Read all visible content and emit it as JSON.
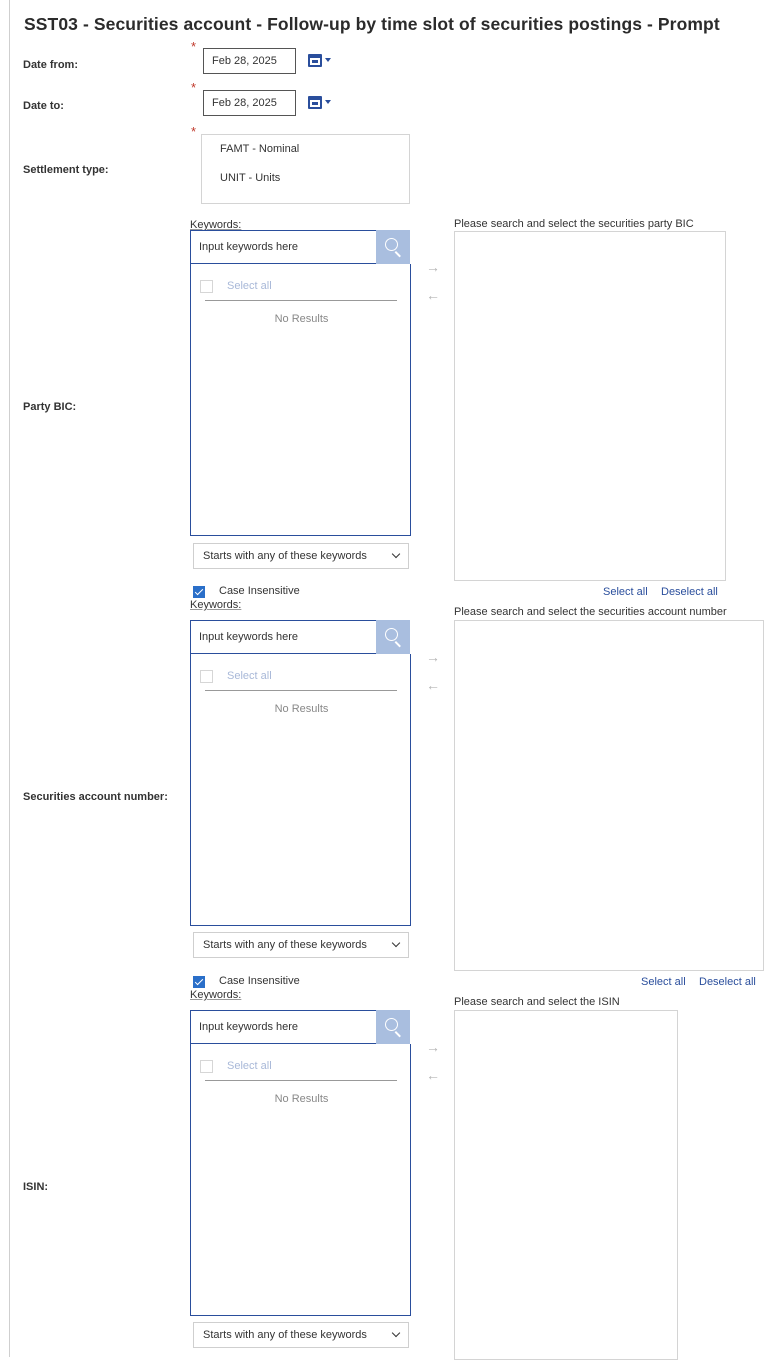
{
  "page": {
    "title": "SST03 - Securities account - Follow-up by time slot of securities postings - Prompt"
  },
  "required_mark": "*",
  "date_from": {
    "label": "Date from:",
    "value": "Feb 28, 2025"
  },
  "date_to": {
    "label": "Date to:",
    "value": "Feb 28, 2025"
  },
  "settlement_type": {
    "label": "Settlement type:",
    "options": [
      "FAMT - Nominal",
      "UNIT - Units"
    ]
  },
  "party_bic": {
    "label": "Party BIC:",
    "keywords_label": "Keywords:",
    "placeholder": "Input keywords here",
    "select_all": "Select all",
    "no_results": "No Results",
    "right_label": "Please search and select the securities party BIC",
    "match_mode": "Starts with any of these keywords",
    "case_insensitive": "Case Insensitive",
    "select_all_link": "Select all",
    "deselect_all_link": "Deselect all"
  },
  "securities_account": {
    "label": "Securities account number:",
    "keywords_label": "Keywords:",
    "placeholder": "Input keywords here",
    "select_all": "Select all",
    "no_results": "No Results",
    "right_label": "Please search and select the securities account number",
    "match_mode": "Starts with any of these keywords",
    "case_insensitive": "Case Insensitive",
    "select_all_link": "Select all",
    "deselect_all_link": "Deselect all"
  },
  "isin": {
    "label": "ISIN:",
    "keywords_label": "Keywords:",
    "placeholder": "Input keywords here",
    "select_all": "Select all",
    "no_results": "No Results",
    "right_label": "Please search and select the ISIN",
    "match_mode": "Starts with any of these keywords"
  },
  "icons": {
    "calendar": "calendar-icon",
    "search": "search-icon",
    "add_arrow": "→",
    "remove_arrow": "←"
  },
  "colors": {
    "accent": "#2a4e9c",
    "search_button": "#a9bedf",
    "required": "#c0392b",
    "checkbox": "#2a6fc9"
  }
}
